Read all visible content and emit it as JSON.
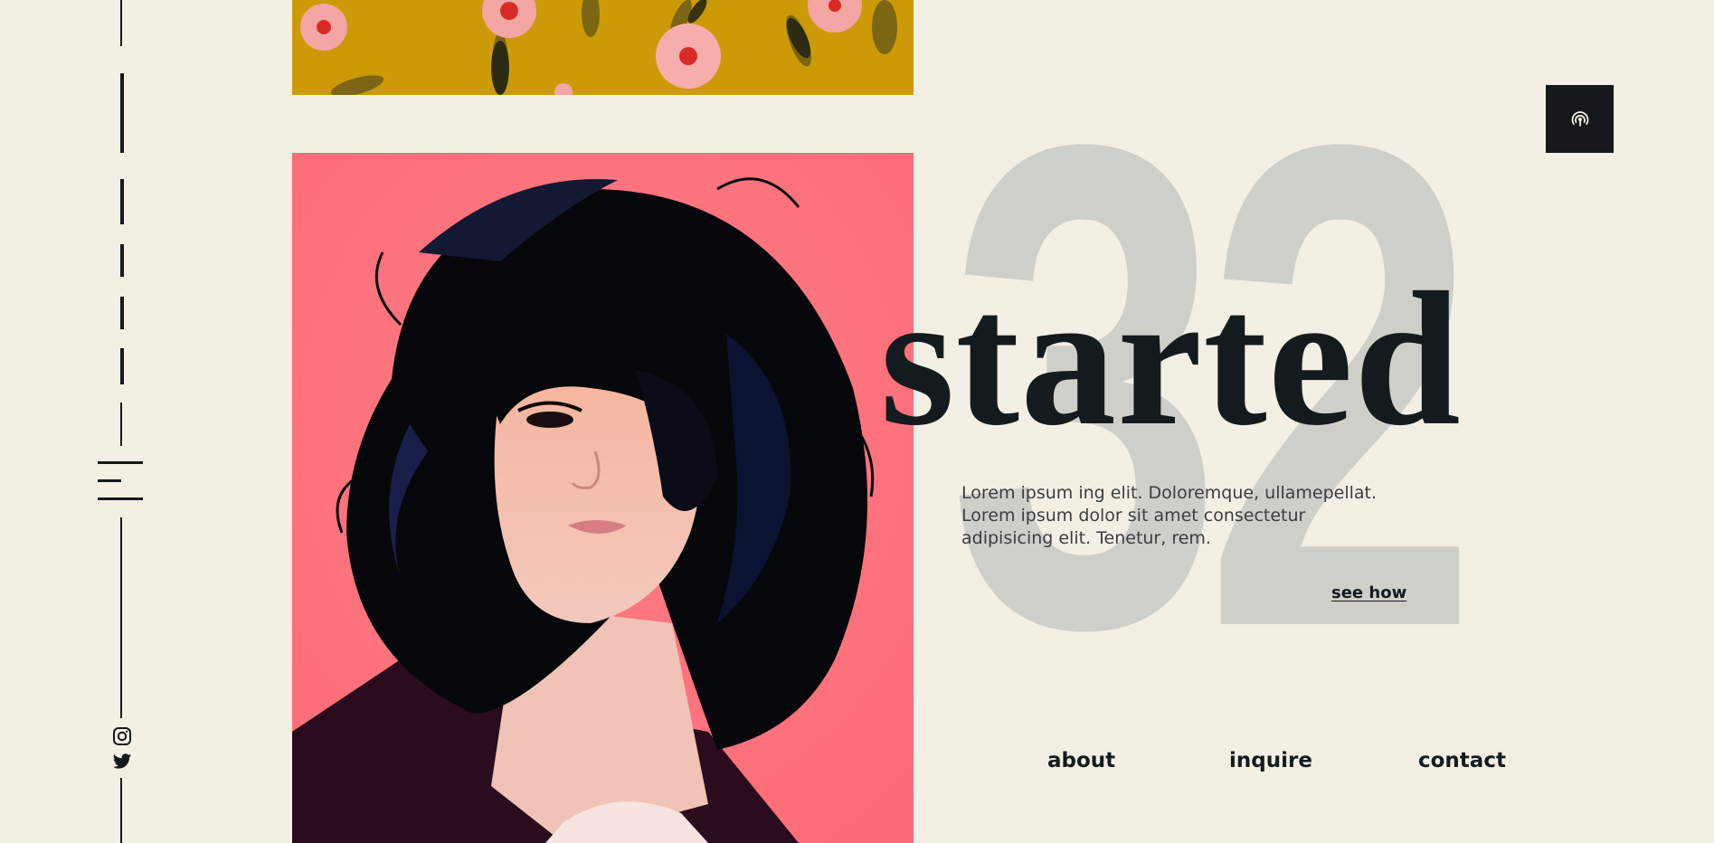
{
  "hero": {
    "numeral": "32",
    "headline": "started",
    "body_lines": [
      "Lorem ipsum ing elit. Doloremque, ullamepellat.",
      "Lorem ipsum dolor sit amet consectetur",
      "adipisicing elit. Tenetur, rem."
    ],
    "cta_label": "see how"
  },
  "nav": {
    "about": "about",
    "inquire": "inquire",
    "contact": "contact"
  },
  "icons": {
    "menu": "menu-icon",
    "instagram": "instagram-icon",
    "twitter": "twitter-icon",
    "corner": "broadcast-icon"
  },
  "colors": {
    "background": "#f3efe5",
    "dark": "#131b1e",
    "numeral": "#cfcfca",
    "mustard": "#cc9a06",
    "coral": "#ff6f7b"
  }
}
